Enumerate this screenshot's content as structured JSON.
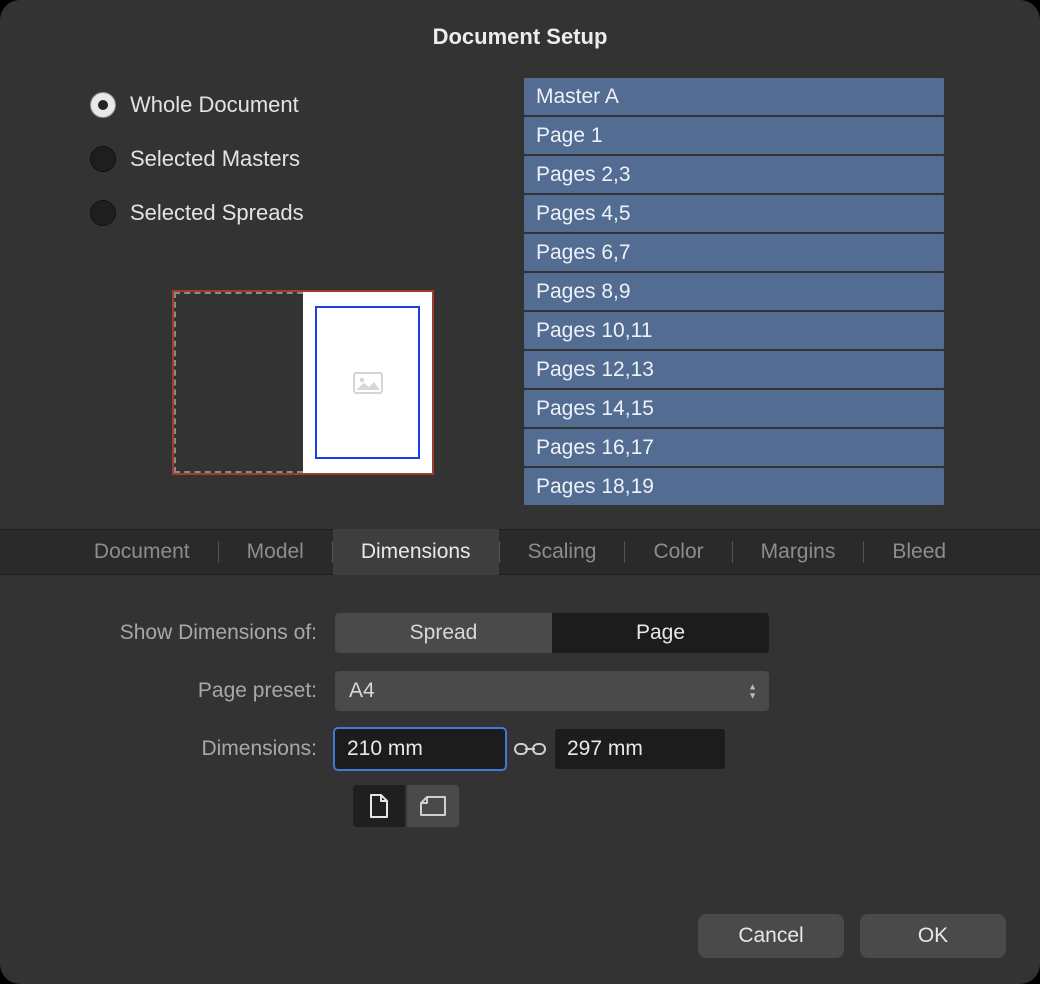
{
  "title": "Document Setup",
  "scope": {
    "options": [
      {
        "label": "Whole Document",
        "checked": true
      },
      {
        "label": "Selected Masters",
        "checked": false
      },
      {
        "label": "Selected Spreads",
        "checked": false
      }
    ]
  },
  "pages": [
    "Master A",
    "Page 1",
    "Pages 2,3",
    "Pages 4,5",
    "Pages 6,7",
    "Pages 8,9",
    "Pages 10,11",
    "Pages 12,13",
    "Pages 14,15",
    "Pages 16,17",
    "Pages 18,19"
  ],
  "tabs": {
    "items": [
      "Document",
      "Model",
      "Dimensions",
      "Scaling",
      "Color",
      "Margins",
      "Bleed"
    ],
    "active": "Dimensions"
  },
  "form": {
    "show_dimensions_label": "Show Dimensions of:",
    "seg_spread": "Spread",
    "seg_page": "Page",
    "seg_active": "Page",
    "page_preset_label": "Page preset:",
    "page_preset_value": "A4",
    "dimensions_label": "Dimensions:",
    "width": "210 mm",
    "height": "297 mm",
    "orientation": "portrait"
  },
  "actions": {
    "cancel": "Cancel",
    "ok": "OK"
  }
}
